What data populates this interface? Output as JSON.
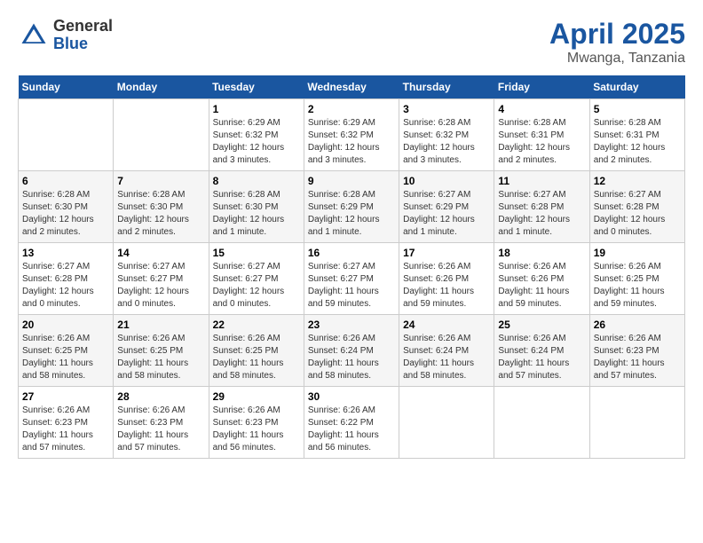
{
  "logo": {
    "general": "General",
    "blue": "Blue"
  },
  "title": "April 2025",
  "location": "Mwanga, Tanzania",
  "days_of_week": [
    "Sunday",
    "Monday",
    "Tuesday",
    "Wednesday",
    "Thursday",
    "Friday",
    "Saturday"
  ],
  "weeks": [
    [
      {
        "day": "",
        "info": ""
      },
      {
        "day": "",
        "info": ""
      },
      {
        "day": "1",
        "info": "Sunrise: 6:29 AM\nSunset: 6:32 PM\nDaylight: 12 hours and 3 minutes."
      },
      {
        "day": "2",
        "info": "Sunrise: 6:29 AM\nSunset: 6:32 PM\nDaylight: 12 hours and 3 minutes."
      },
      {
        "day": "3",
        "info": "Sunrise: 6:28 AM\nSunset: 6:32 PM\nDaylight: 12 hours and 3 minutes."
      },
      {
        "day": "4",
        "info": "Sunrise: 6:28 AM\nSunset: 6:31 PM\nDaylight: 12 hours and 2 minutes."
      },
      {
        "day": "5",
        "info": "Sunrise: 6:28 AM\nSunset: 6:31 PM\nDaylight: 12 hours and 2 minutes."
      }
    ],
    [
      {
        "day": "6",
        "info": "Sunrise: 6:28 AM\nSunset: 6:30 PM\nDaylight: 12 hours and 2 minutes."
      },
      {
        "day": "7",
        "info": "Sunrise: 6:28 AM\nSunset: 6:30 PM\nDaylight: 12 hours and 2 minutes."
      },
      {
        "day": "8",
        "info": "Sunrise: 6:28 AM\nSunset: 6:30 PM\nDaylight: 12 hours and 1 minute."
      },
      {
        "day": "9",
        "info": "Sunrise: 6:28 AM\nSunset: 6:29 PM\nDaylight: 12 hours and 1 minute."
      },
      {
        "day": "10",
        "info": "Sunrise: 6:27 AM\nSunset: 6:29 PM\nDaylight: 12 hours and 1 minute."
      },
      {
        "day": "11",
        "info": "Sunrise: 6:27 AM\nSunset: 6:28 PM\nDaylight: 12 hours and 1 minute."
      },
      {
        "day": "12",
        "info": "Sunrise: 6:27 AM\nSunset: 6:28 PM\nDaylight: 12 hours and 0 minutes."
      }
    ],
    [
      {
        "day": "13",
        "info": "Sunrise: 6:27 AM\nSunset: 6:28 PM\nDaylight: 12 hours and 0 minutes."
      },
      {
        "day": "14",
        "info": "Sunrise: 6:27 AM\nSunset: 6:27 PM\nDaylight: 12 hours and 0 minutes."
      },
      {
        "day": "15",
        "info": "Sunrise: 6:27 AM\nSunset: 6:27 PM\nDaylight: 12 hours and 0 minutes."
      },
      {
        "day": "16",
        "info": "Sunrise: 6:27 AM\nSunset: 6:27 PM\nDaylight: 11 hours and 59 minutes."
      },
      {
        "day": "17",
        "info": "Sunrise: 6:26 AM\nSunset: 6:26 PM\nDaylight: 11 hours and 59 minutes."
      },
      {
        "day": "18",
        "info": "Sunrise: 6:26 AM\nSunset: 6:26 PM\nDaylight: 11 hours and 59 minutes."
      },
      {
        "day": "19",
        "info": "Sunrise: 6:26 AM\nSunset: 6:25 PM\nDaylight: 11 hours and 59 minutes."
      }
    ],
    [
      {
        "day": "20",
        "info": "Sunrise: 6:26 AM\nSunset: 6:25 PM\nDaylight: 11 hours and 58 minutes."
      },
      {
        "day": "21",
        "info": "Sunrise: 6:26 AM\nSunset: 6:25 PM\nDaylight: 11 hours and 58 minutes."
      },
      {
        "day": "22",
        "info": "Sunrise: 6:26 AM\nSunset: 6:25 PM\nDaylight: 11 hours and 58 minutes."
      },
      {
        "day": "23",
        "info": "Sunrise: 6:26 AM\nSunset: 6:24 PM\nDaylight: 11 hours and 58 minutes."
      },
      {
        "day": "24",
        "info": "Sunrise: 6:26 AM\nSunset: 6:24 PM\nDaylight: 11 hours and 58 minutes."
      },
      {
        "day": "25",
        "info": "Sunrise: 6:26 AM\nSunset: 6:24 PM\nDaylight: 11 hours and 57 minutes."
      },
      {
        "day": "26",
        "info": "Sunrise: 6:26 AM\nSunset: 6:23 PM\nDaylight: 11 hours and 57 minutes."
      }
    ],
    [
      {
        "day": "27",
        "info": "Sunrise: 6:26 AM\nSunset: 6:23 PM\nDaylight: 11 hours and 57 minutes."
      },
      {
        "day": "28",
        "info": "Sunrise: 6:26 AM\nSunset: 6:23 PM\nDaylight: 11 hours and 57 minutes."
      },
      {
        "day": "29",
        "info": "Sunrise: 6:26 AM\nSunset: 6:23 PM\nDaylight: 11 hours and 56 minutes."
      },
      {
        "day": "30",
        "info": "Sunrise: 6:26 AM\nSunset: 6:22 PM\nDaylight: 11 hours and 56 minutes."
      },
      {
        "day": "",
        "info": ""
      },
      {
        "day": "",
        "info": ""
      },
      {
        "day": "",
        "info": ""
      }
    ]
  ]
}
